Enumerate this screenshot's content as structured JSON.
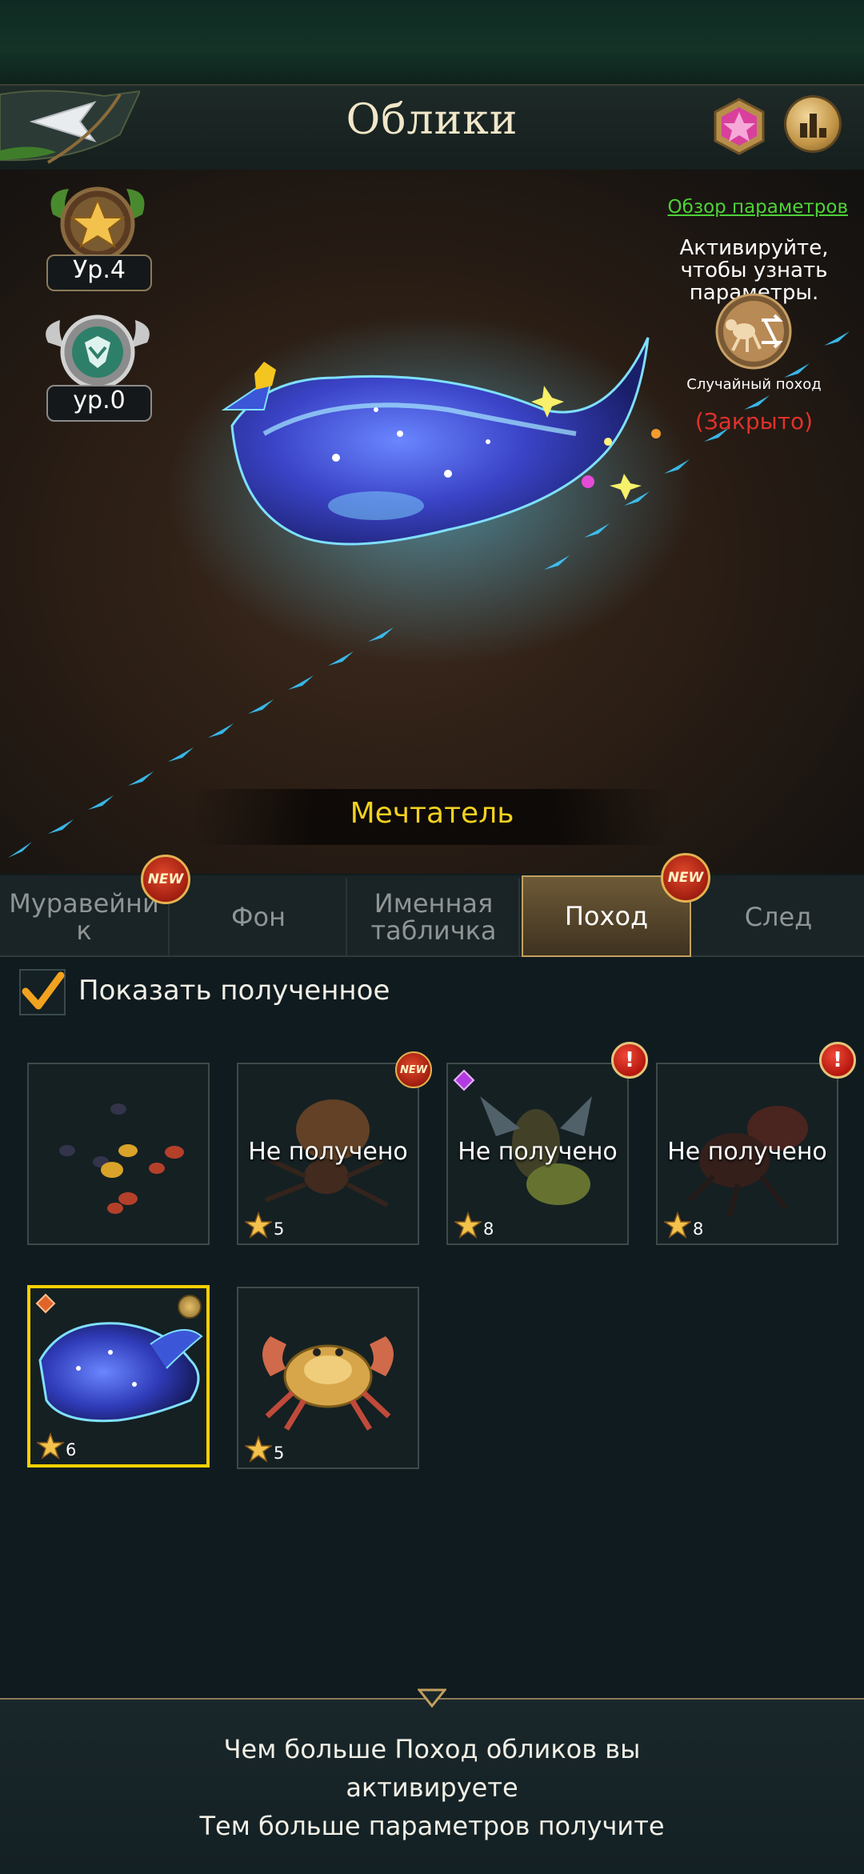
{
  "header": {
    "title": "Облики",
    "back_icon": "back-arrow-icon",
    "crystal_icon": "pink-crystal-icon",
    "rank_icon": "leaderboard-icon"
  },
  "levels": [
    {
      "label": "Ур.4",
      "icon": "star-medal-icon"
    },
    {
      "label": "ур.0",
      "icon": "ant-emblem-icon"
    }
  ],
  "info_panel": {
    "overview_link": "Обзор параметров",
    "activate_text": "Активируйте, чтобы узнать параметры.",
    "march_label": "Случайный поход",
    "status": "(Закрыто)"
  },
  "skin_name": "Мечтатель",
  "tabs": [
    {
      "label": "Муравейник",
      "new_badge": "NEW",
      "active": false
    },
    {
      "label": "Фон",
      "active": false
    },
    {
      "label": "Именная табличка",
      "active": false
    },
    {
      "label": "Поход",
      "new_badge": "NEW",
      "active": true
    },
    {
      "label": "След",
      "active": false
    }
  ],
  "filter": {
    "show_obtained_label": "Показать полученное",
    "checked": true
  },
  "items": [
    {
      "name": "ant-group",
      "overlay": "",
      "stars": ""
    },
    {
      "name": "spider",
      "overlay": "Не получено",
      "stars": "5",
      "badge": "NEW"
    },
    {
      "name": "firefly",
      "overlay": "Не получено",
      "stars": "8",
      "badge": "!"
    },
    {
      "name": "beetle",
      "overlay": "Не получено",
      "stars": "8",
      "badge": "!"
    },
    {
      "name": "dreamer-whale",
      "overlay": "",
      "stars": "6",
      "selected": true
    },
    {
      "name": "golden-crab",
      "overlay": "",
      "stars": "5"
    }
  ],
  "footer": {
    "line1": "Чем больше Поход обликов вы",
    "line2": "активируете",
    "line3": "Тем больше параметров получите"
  },
  "colors": {
    "accent_gold": "#c3a05e",
    "skin_name": "#f3d21f",
    "link_green": "#4ed239",
    "closed_red": "#e0312b",
    "selected_border": "#f4d100"
  }
}
